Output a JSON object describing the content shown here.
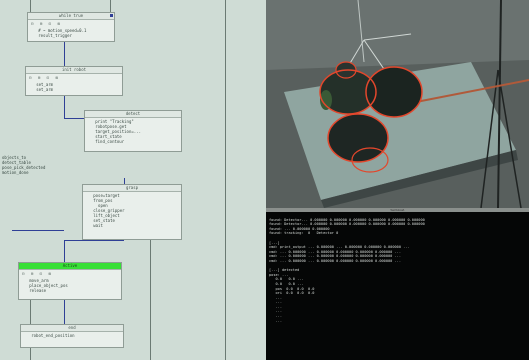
{
  "graph": {
    "nodes": [
      {
        "title": "while true",
        "icons": "⊟ ⊞ ⊡ ⊠",
        "lines": [
          "   # ~ motion_speed=0.1",
          "   result_trigger"
        ]
      },
      {
        "title": "init robot",
        "icons": "⊟ ⊞ ⊡ ⊠",
        "lines": [
          "   set_arm",
          "   set_arm"
        ]
      },
      {
        "title": "detect",
        "icons": "⊟ ⊞ ⊡ ⊠",
        "lines": [
          "   print \"Tracking\"",
          "   robotpose.get",
          "   target_position=...",
          "   start_state",
          "   find_contour"
        ]
      },
      {
        "title": "grasp",
        "icons": "⊟ ⊞ ⊡ ⊠",
        "lines": [
          "   pose=target",
          "   from_pos",
          "     open",
          "   close_gripper",
          "   lift_object",
          "   set_state",
          "   wait"
        ]
      },
      {
        "title": "Active",
        "icons": "⊟ ⊞ ⊡ ⊠",
        "lines": [
          "   move_arm",
          "   place_object_pos",
          "   release"
        ]
      },
      {
        "title": "end",
        "icons": "⊟ ⊞ ⊡ ⊠",
        "lines": [
          "   robot_end_position"
        ]
      }
    ],
    "side_text": [
      "objects_to",
      "detect_table",
      "pose_pick_detected",
      "motion_done"
    ]
  },
  "terminal": {
    "title": "terminal",
    "lines": [
      "found: Detector... 0.000000 0.000000 0.000000 0.000000 0.000000 0.000000",
      "found: Detector... 0.000000 0.000000 0.000000 0.000000 0.000000 0.000000",
      "found: ... 0.000000 0.000000",
      "found: tracking:  0   Detector 0",
      "",
      "[...]",
      "cmd: print_output ... 0.000000 ... 0.000000 0.000000 0.000000 ...",
      "cmd: ... 0.000000 ... 0.000000 0.000000 0.000000 0.000000 ...",
      "cmd: ... 0.000000 ... 0.000000 0.000000 0.000000 0.000000 ...",
      "cmd: ... 0.000000 ... 0.000000 0.000000 0.000000 0.000000 ...",
      "",
      "[...] detected",
      "pose: ...",
      "   0.0   0.0 ...",
      "   0.0   0.0 ...",
      "   pos  0.0  0.0  0.0",
      "   ori  0.0  0.0  0.0",
      "   ...",
      "   ...",
      "   ...",
      "   ...",
      "   ...",
      "   ..."
    ]
  },
  "colors": {
    "graph_bg": "#cfdcd5",
    "wire": "#2f3f96",
    "active_header": "#37e036",
    "detection_outline": "#e2472c",
    "terminal_bg": "#050606"
  }
}
